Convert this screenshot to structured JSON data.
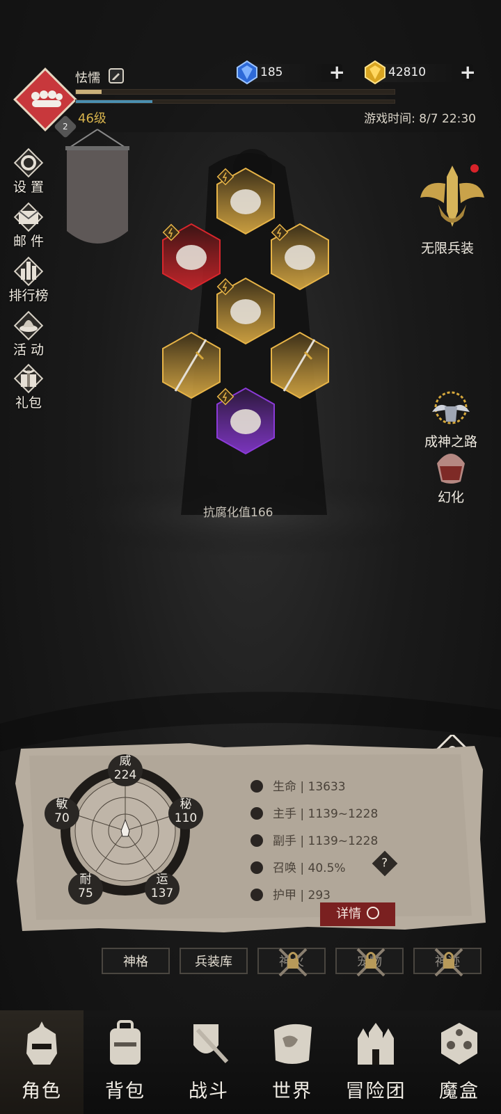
{
  "player": {
    "name": "怯懦",
    "level": "46级",
    "rank": "2",
    "exp_progress": 0.08,
    "hp_progress": 0.24
  },
  "currencies": [
    {
      "icon": "blue-crystal-icon",
      "value": "185"
    },
    {
      "icon": "gold-crystal-icon",
      "value": "42810"
    }
  ],
  "game_time": "游戏时间: 8/7 22:30",
  "side_menu": [
    {
      "icon": "gear-icon",
      "label": "设 置"
    },
    {
      "icon": "mail-icon",
      "label": "邮 件"
    },
    {
      "icon": "ranking-icon",
      "label": "排行榜"
    },
    {
      "icon": "activity-icon",
      "label": "活 动"
    },
    {
      "icon": "gift-icon",
      "label": "礼包"
    }
  ],
  "right_menu": {
    "infinite_gear": "无限兵装",
    "road_to_god": "成神之路",
    "transform": "幻化"
  },
  "equipment": [
    {
      "slot": "hat",
      "rarity": "gold"
    },
    {
      "slot": "chest",
      "rarity": "red"
    },
    {
      "slot": "ring",
      "rarity": "gold"
    },
    {
      "slot": "armor",
      "rarity": "gold"
    },
    {
      "slot": "main-weapon",
      "rarity": "gold"
    },
    {
      "slot": "off-weapon",
      "rarity": "gold"
    },
    {
      "slot": "boots",
      "rarity": "purple"
    }
  ],
  "resistance": "抗腐化值166",
  "attributes": {
    "wei": {
      "name": "威",
      "value": "224"
    },
    "mi": {
      "name": "秘",
      "value": "110"
    },
    "yun": {
      "name": "运",
      "value": "137"
    },
    "nai": {
      "name": "耐",
      "value": "75"
    },
    "min": {
      "name": "敏",
      "value": "70"
    }
  },
  "stats": [
    {
      "icon": "heart-icon",
      "label": "生命",
      "value": "13633"
    },
    {
      "icon": "main-hand-icon",
      "label": "主手",
      "value": "1139~1228"
    },
    {
      "icon": "off-hand-icon",
      "label": "副手",
      "value": "1139~1228"
    },
    {
      "icon": "summon-icon",
      "label": "召唤",
      "value": "40.5%"
    },
    {
      "icon": "armor-icon",
      "label": "护甲",
      "value": "293"
    }
  ],
  "detail_button": "详情",
  "tabs": [
    {
      "label": "神格",
      "locked": false
    },
    {
      "label": "兵装库",
      "locked": false
    },
    {
      "label": "神火",
      "locked": true
    },
    {
      "label": "宠物",
      "locked": true
    },
    {
      "label": "神迹",
      "locked": true
    }
  ],
  "nav": [
    {
      "icon": "helmet-icon",
      "label": "角色"
    },
    {
      "icon": "backpack-icon",
      "label": "背包"
    },
    {
      "icon": "shield-sword-icon",
      "label": "战斗"
    },
    {
      "icon": "world-map-icon",
      "label": "世界"
    },
    {
      "icon": "castle-icon",
      "label": "冒险团"
    },
    {
      "icon": "magic-box-icon",
      "label": "魔盒"
    }
  ]
}
